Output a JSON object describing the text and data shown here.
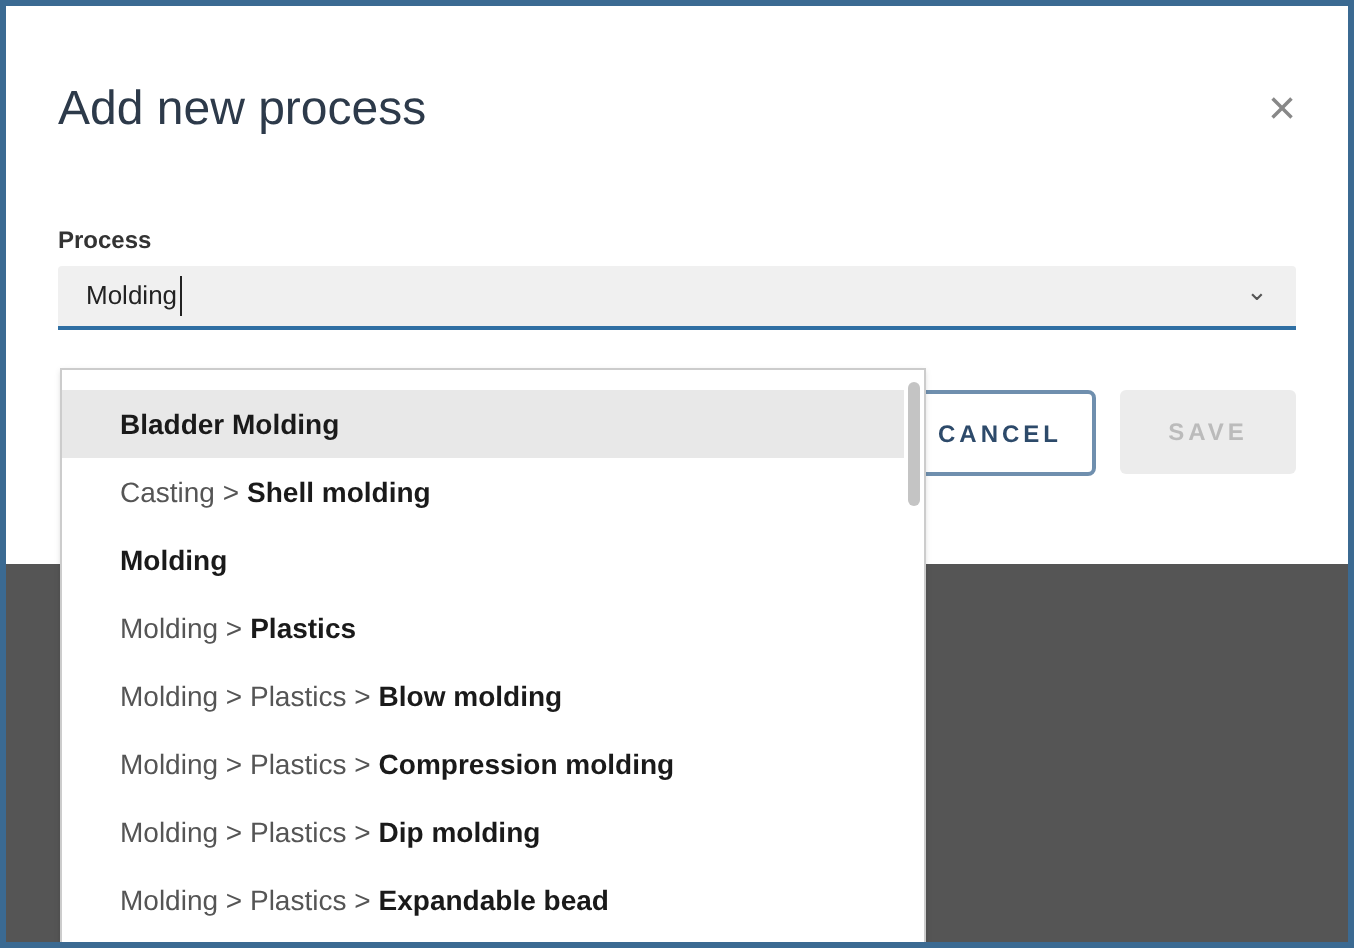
{
  "dialog": {
    "title": "Add new process",
    "close": "×"
  },
  "field": {
    "label": "Process",
    "value": "Molding",
    "caret": "⌄"
  },
  "options": [
    {
      "match": "Bladder Molding",
      "selected": true
    },
    {
      "prefix": "Casting >",
      "match": "Shell molding",
      "selected": false
    },
    {
      "match": "Molding",
      "selected": false
    },
    {
      "prefix": "Molding >",
      "match": "Plastics",
      "selected": false
    },
    {
      "prefix": "Molding > Plastics >",
      "match": "Blow molding",
      "selected": false
    },
    {
      "prefix": "Molding > Plastics >",
      "match": "Compression molding",
      "selected": false
    },
    {
      "prefix": "Molding > Plastics >",
      "match": "Dip molding",
      "selected": false
    },
    {
      "prefix": "Molding > Plastics >",
      "match": "Expandable bead",
      "selected": false
    }
  ],
  "buttons": [
    {
      "label": "CANCEL",
      "disabled": false
    },
    {
      "label": "SAVE",
      "disabled": true
    }
  ]
}
